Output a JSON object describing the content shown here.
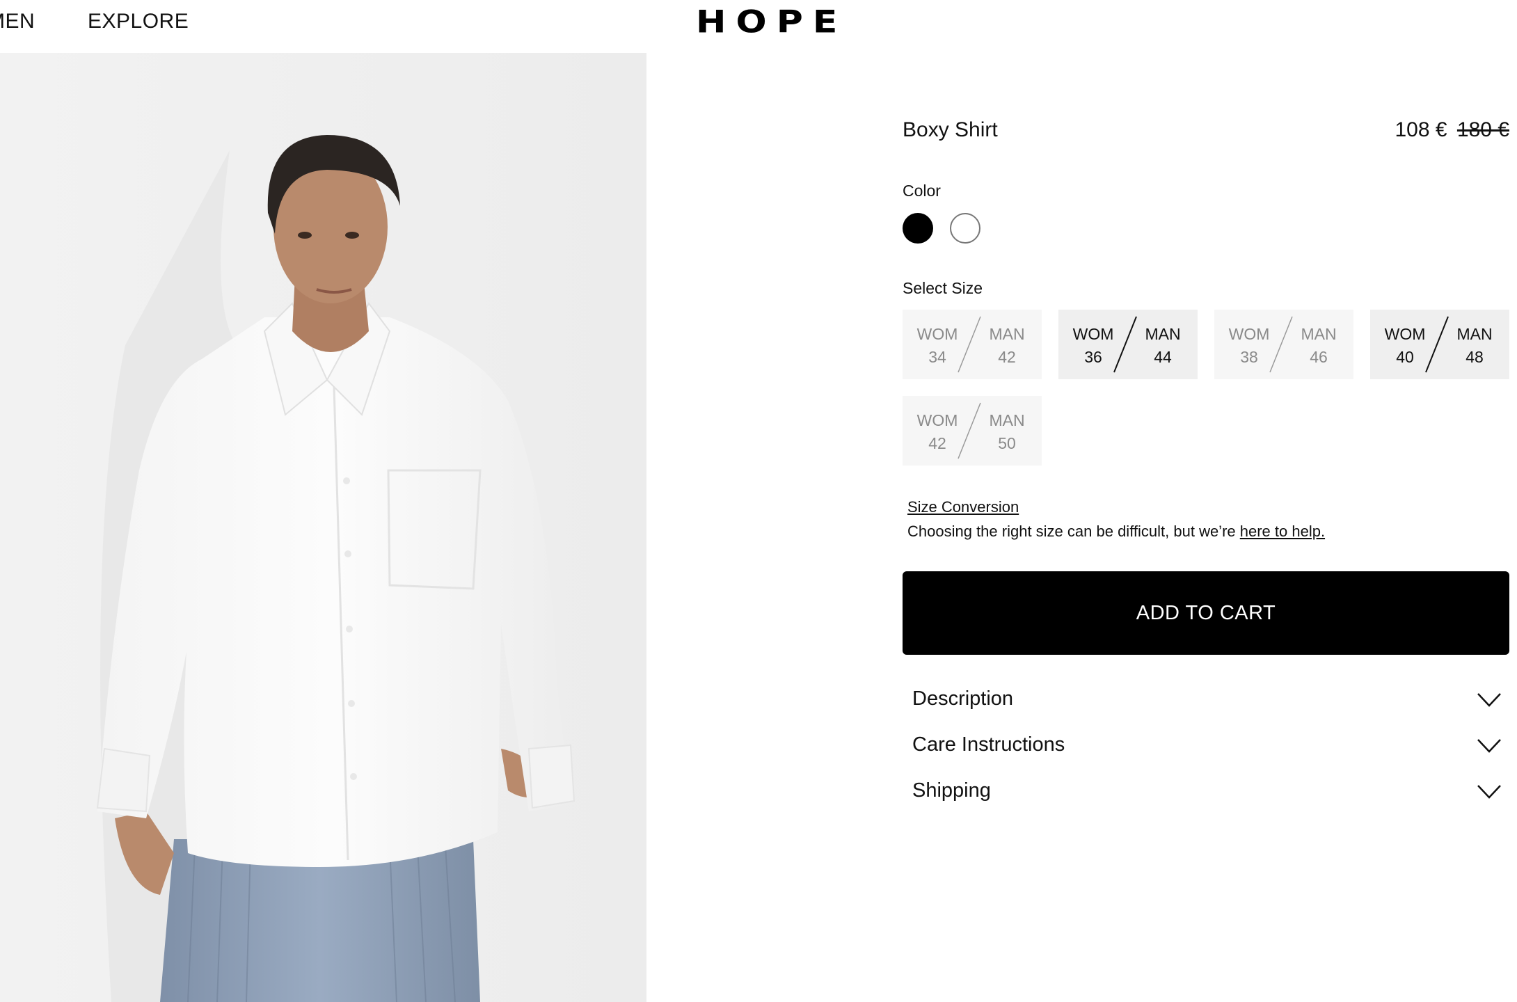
{
  "nav": {
    "items": [
      {
        "label": "MEN"
      },
      {
        "label": "EXPLORE"
      }
    ],
    "logo": "HOPE"
  },
  "product": {
    "name": "Boxy Shirt",
    "price": "108 €",
    "original_price": "180 €",
    "image_icon": "product-photo-white-shirt"
  },
  "color": {
    "label": "Color",
    "options": [
      {
        "name": "black",
        "hex": "#000000",
        "selected": true
      },
      {
        "name": "white",
        "hex": "#ffffff",
        "selected": false
      }
    ]
  },
  "size": {
    "label": "Select Size",
    "options": [
      {
        "wom_label": "WOM",
        "wom": "34",
        "man_label": "MAN",
        "man": "42",
        "available": false
      },
      {
        "wom_label": "WOM",
        "wom": "36",
        "man_label": "MAN",
        "man": "44",
        "available": true
      },
      {
        "wom_label": "WOM",
        "wom": "38",
        "man_label": "MAN",
        "man": "46",
        "available": false
      },
      {
        "wom_label": "WOM",
        "wom": "40",
        "man_label": "MAN",
        "man": "48",
        "available": true
      },
      {
        "wom_label": "WOM",
        "wom": "42",
        "man_label": "MAN",
        "man": "50",
        "available": false
      }
    ],
    "conversion_link": "Size Conversion",
    "help_text": "Choosing the right size can be difficult, but we’re ",
    "help_link": "here to help."
  },
  "cart": {
    "add_label": "ADD TO CART"
  },
  "accordions": {
    "description": "Description",
    "care": "Care Instructions",
    "shipping": "Shipping"
  },
  "colors": {
    "button_bg": "#000000",
    "unavailable_text": "#8a8a8a",
    "size_bg": "#efefef",
    "image_bg": "#efefef"
  }
}
